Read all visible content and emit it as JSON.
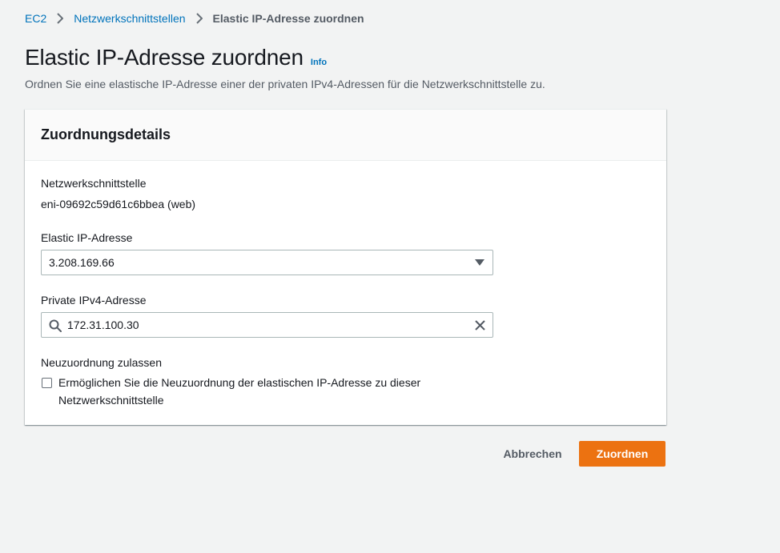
{
  "breadcrumb": {
    "items": [
      {
        "label": "EC2"
      },
      {
        "label": "Netzwerkschnittstellen"
      },
      {
        "label": "Elastic IP-Adresse zuordnen"
      }
    ]
  },
  "header": {
    "title": "Elastic IP-Adresse zuordnen",
    "info_label": "Info",
    "description": "Ordnen Sie eine elastische IP-Adresse einer der privaten IPv4-Adressen für die Netzwerkschnittstelle zu."
  },
  "panel": {
    "title": "Zuordnungsdetails",
    "network_interface": {
      "label": "Netzwerkschnittstelle",
      "value": "eni-09692c59d61c6bbea (web)"
    },
    "elastic_ip": {
      "label": "Elastic IP-Adresse",
      "selected": "3.208.169.66"
    },
    "private_ipv4": {
      "label": "Private IPv4-Adresse",
      "value": "172.31.100.30"
    },
    "reassociation": {
      "label": "Neuzuordnung zulassen",
      "checkbox_label": "Ermöglichen Sie die Neuzuordnung der elastischen IP-Adresse zu dieser Netzwerkschnittstelle",
      "checked": false
    }
  },
  "actions": {
    "cancel_label": "Abbrechen",
    "submit_label": "Zuordnen"
  },
  "colors": {
    "link": "#0073bb",
    "primary": "#ec7211",
    "background": "#f2f3f3"
  }
}
